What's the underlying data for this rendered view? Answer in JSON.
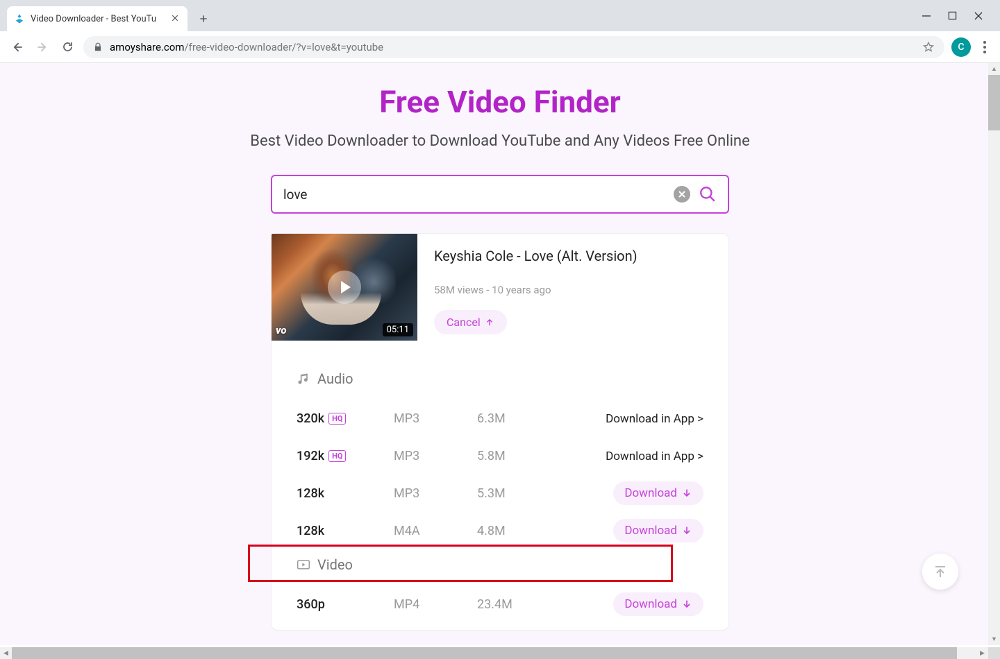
{
  "window": {
    "tab_title": "Video Downloader - Best YouTu",
    "profile_letter": "C"
  },
  "url": {
    "domain": "amoyshare.com",
    "path": "/free-video-downloader/?v=love&t=youtube"
  },
  "hero": {
    "title": "Free Video Finder",
    "subtitle": "Best Video Downloader to Download YouTube and Any Videos Free Online"
  },
  "search": {
    "value": "love"
  },
  "result": {
    "title": "Keyshia Cole - Love (Alt. Version)",
    "meta": "58M views - 10 years ago",
    "duration": "05:11",
    "thumb_logo": "vo",
    "cancel_label": "Cancel"
  },
  "sections": {
    "audio_label": "Audio",
    "video_label": "Video",
    "hq_label": "HQ",
    "app_link_label": "Download in App >",
    "download_label": "Download"
  },
  "audio_rows": [
    {
      "quality": "320k",
      "hq": true,
      "fmt": "MP3",
      "size": "6.3M",
      "action": "app"
    },
    {
      "quality": "192k",
      "hq": true,
      "fmt": "MP3",
      "size": "5.8M",
      "action": "app"
    },
    {
      "quality": "128k",
      "hq": false,
      "fmt": "MP3",
      "size": "5.3M",
      "action": "download"
    },
    {
      "quality": "128k",
      "hq": false,
      "fmt": "M4A",
      "size": "4.8M",
      "action": "download"
    }
  ],
  "video_rows": [
    {
      "quality": "360p",
      "fmt": "MP4",
      "size": "23.4M",
      "action": "download"
    }
  ]
}
